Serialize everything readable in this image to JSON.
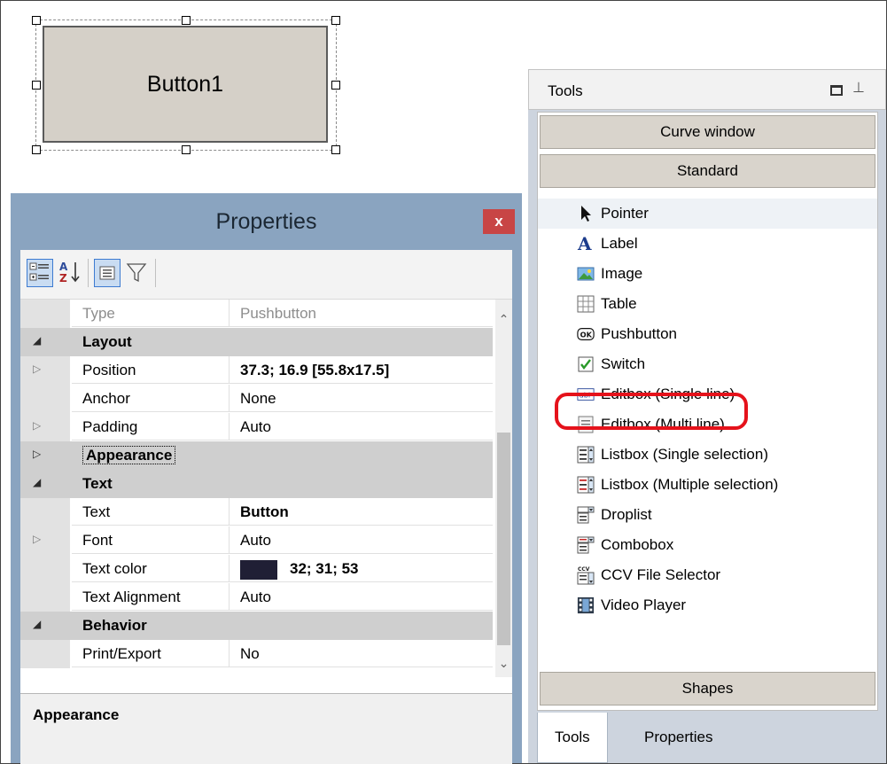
{
  "canvas": {
    "button_label": "Button1"
  },
  "properties": {
    "title": "Properties",
    "close_label": "x",
    "rows": {
      "type": {
        "name": "Type",
        "value": "Pushbutton"
      },
      "layout": "Layout",
      "position": {
        "name": "Position",
        "value": "37.3; 16.9 [55.8x17.5]"
      },
      "anchor": {
        "name": "Anchor",
        "value": "None"
      },
      "padding": {
        "name": "Padding",
        "value": "Auto"
      },
      "appearance": "Appearance",
      "text_cat": "Text",
      "text": {
        "name": "Text",
        "value": "Button"
      },
      "font": {
        "name": "Font",
        "value": "Auto"
      },
      "text_color": {
        "name": "Text color",
        "value": "32; 31; 53",
        "swatch": "#201f35"
      },
      "text_alignment": {
        "name": "Text Alignment",
        "value": "Auto"
      },
      "behavior": "Behavior",
      "print_export": {
        "name": "Print/Export",
        "value": "No"
      }
    },
    "description_title": "Appearance"
  },
  "tools": {
    "title": "Tools",
    "sections": {
      "curve": "Curve window",
      "standard": "Standard",
      "shapes": "Shapes"
    },
    "items": [
      {
        "label": "Pointer",
        "icon": "pointer-icon"
      },
      {
        "label": "Label",
        "icon": "label-icon"
      },
      {
        "label": "Image",
        "icon": "image-icon"
      },
      {
        "label": "Table",
        "icon": "table-icon"
      },
      {
        "label": "Pushbutton",
        "icon": "pushbutton-icon",
        "icon_text": "OK"
      },
      {
        "label": "Switch",
        "icon": "switch-icon"
      },
      {
        "label": "Editbox (Single line)",
        "icon": "editbox-single-icon",
        "icon_text": "abl"
      },
      {
        "label": "Editbox (Multi line)",
        "icon": "editbox-multi-icon"
      },
      {
        "label": "Listbox (Single selection)",
        "icon": "listbox-single-icon"
      },
      {
        "label": "Listbox (Multiple selection)",
        "icon": "listbox-multi-icon"
      },
      {
        "label": "Droplist",
        "icon": "droplist-icon"
      },
      {
        "label": "Combobox",
        "icon": "combobox-icon"
      },
      {
        "label": "CCV File Selector",
        "icon": "ccv-file-selector-icon",
        "icon_text": "CCV"
      },
      {
        "label": "Video Player",
        "icon": "video-player-icon"
      }
    ],
    "tabs": {
      "tools": "Tools",
      "properties": "Properties"
    }
  }
}
